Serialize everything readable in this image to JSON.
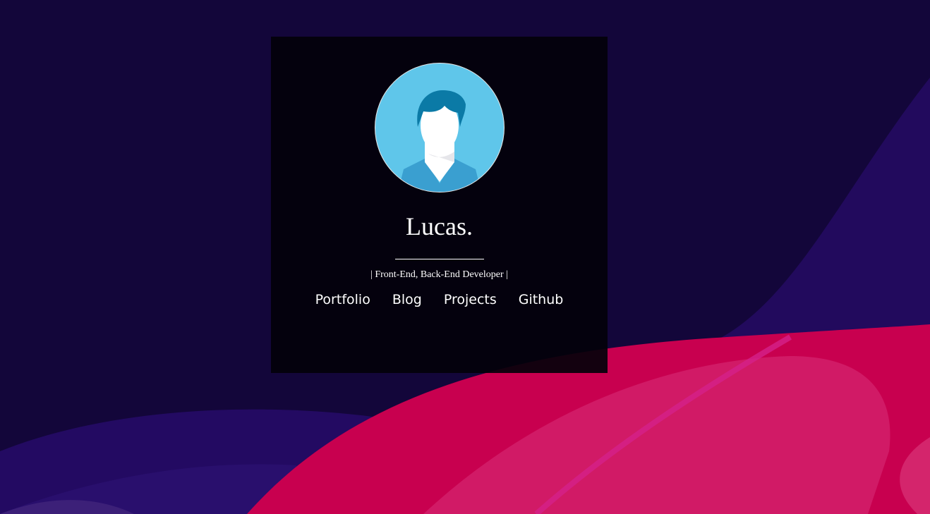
{
  "profile": {
    "name": "Lucas.",
    "subtitle": "| Front-End, Back-End Developer |",
    "avatar_icon": "user-avatar-icon"
  },
  "nav": {
    "items": [
      {
        "label": "Portfolio"
      },
      {
        "label": "Blog"
      },
      {
        "label": "Projects"
      },
      {
        "label": "Github"
      }
    ]
  },
  "colors": {
    "background": "#13063a",
    "wave_pink": "#c8004f",
    "wave_purple": "#2a0a6a",
    "avatar_bg": "#5fc6ea",
    "hair": "#0b7aa6"
  }
}
